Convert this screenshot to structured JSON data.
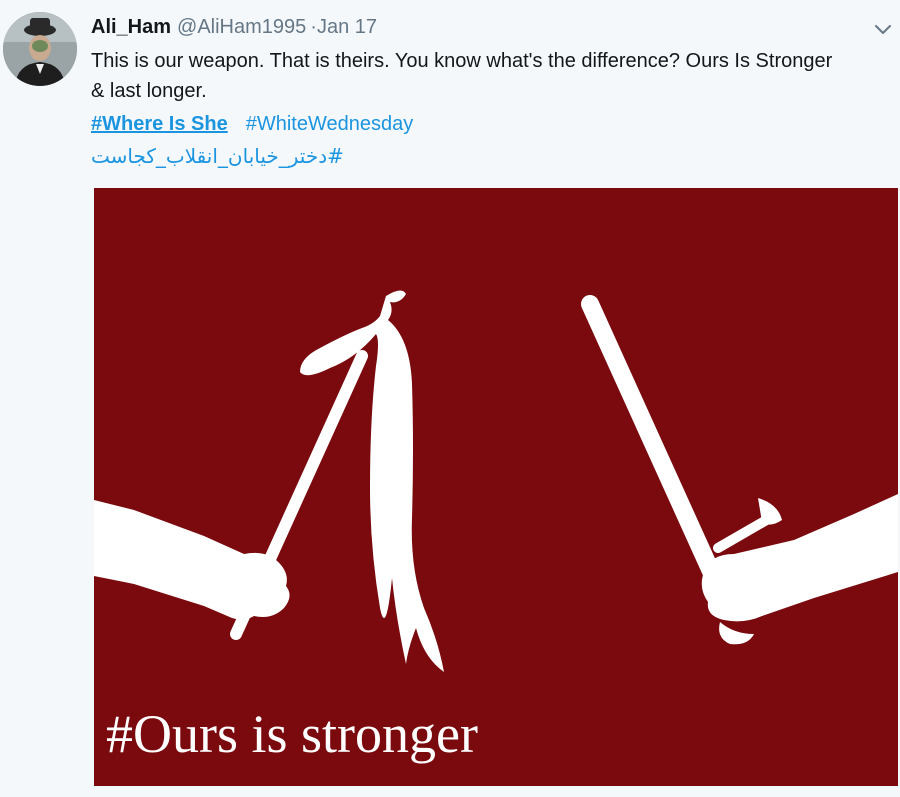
{
  "tweet": {
    "author_name": "Ali_Ham",
    "author_handle": "@AliHam1995",
    "separator": "·",
    "date": "Jan 17",
    "text": "This is our weapon. That is theirs. You know what's the difference? Ours Is Stronger & last longer.",
    "hashtags": [
      "#Where Is She",
      "#WhiteWednesday"
    ],
    "hashtag_rtl": "#دختر_خیابان_انقلاب_کجاست",
    "icons": {
      "avatar": "avatar-image",
      "menu": "chevron-down-icon"
    }
  },
  "media": {
    "caption": "#Ours is stronger",
    "background_color": "#7a0a0e",
    "foreground_color": "#ffffff"
  }
}
